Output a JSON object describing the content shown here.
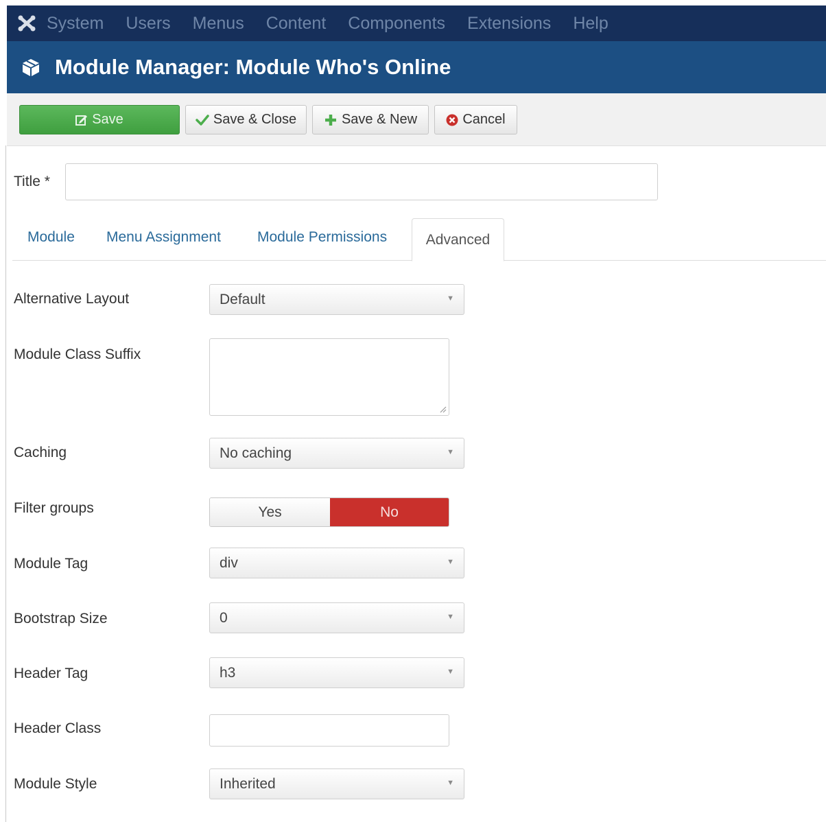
{
  "colors": {
    "navbar": "#162f5a",
    "header": "#1c4f83",
    "save_button": "#4cae4c",
    "toggle_active_no": "#c9302c",
    "tab_link": "#2a6a9a"
  },
  "navbar": {
    "logo_icon": "joomla-logo-icon",
    "items": [
      "System",
      "Users",
      "Menus",
      "Content",
      "Components",
      "Extensions",
      "Help"
    ]
  },
  "header": {
    "icon": "cube-icon",
    "title": "Module Manager: Module Who's Online"
  },
  "toolbar": {
    "save_label": "Save",
    "save_close_label": "Save & Close",
    "save_new_label": "Save & New",
    "cancel_label": "Cancel"
  },
  "title_field": {
    "label": "Title *",
    "value": ""
  },
  "tabs": [
    {
      "label": "Module",
      "active": false
    },
    {
      "label": "Menu Assignment",
      "active": false
    },
    {
      "label": "Module Permissions",
      "active": false
    },
    {
      "label": "Advanced",
      "active": true
    }
  ],
  "fields": {
    "alternative_layout": {
      "label": "Alternative Layout",
      "value": "Default"
    },
    "module_class_suffix": {
      "label": "Module Class Suffix",
      "value": ""
    },
    "caching": {
      "label": "Caching",
      "value": "No caching"
    },
    "filter_groups": {
      "label": "Filter groups",
      "yes_label": "Yes",
      "no_label": "No",
      "selected": "No"
    },
    "module_tag": {
      "label": "Module Tag",
      "value": "div"
    },
    "bootstrap_size": {
      "label": "Bootstrap Size",
      "value": "0"
    },
    "header_tag": {
      "label": "Header Tag",
      "value": "h3"
    },
    "header_class": {
      "label": "Header Class",
      "value": ""
    },
    "module_style": {
      "label": "Module Style",
      "value": "Inherited"
    }
  }
}
